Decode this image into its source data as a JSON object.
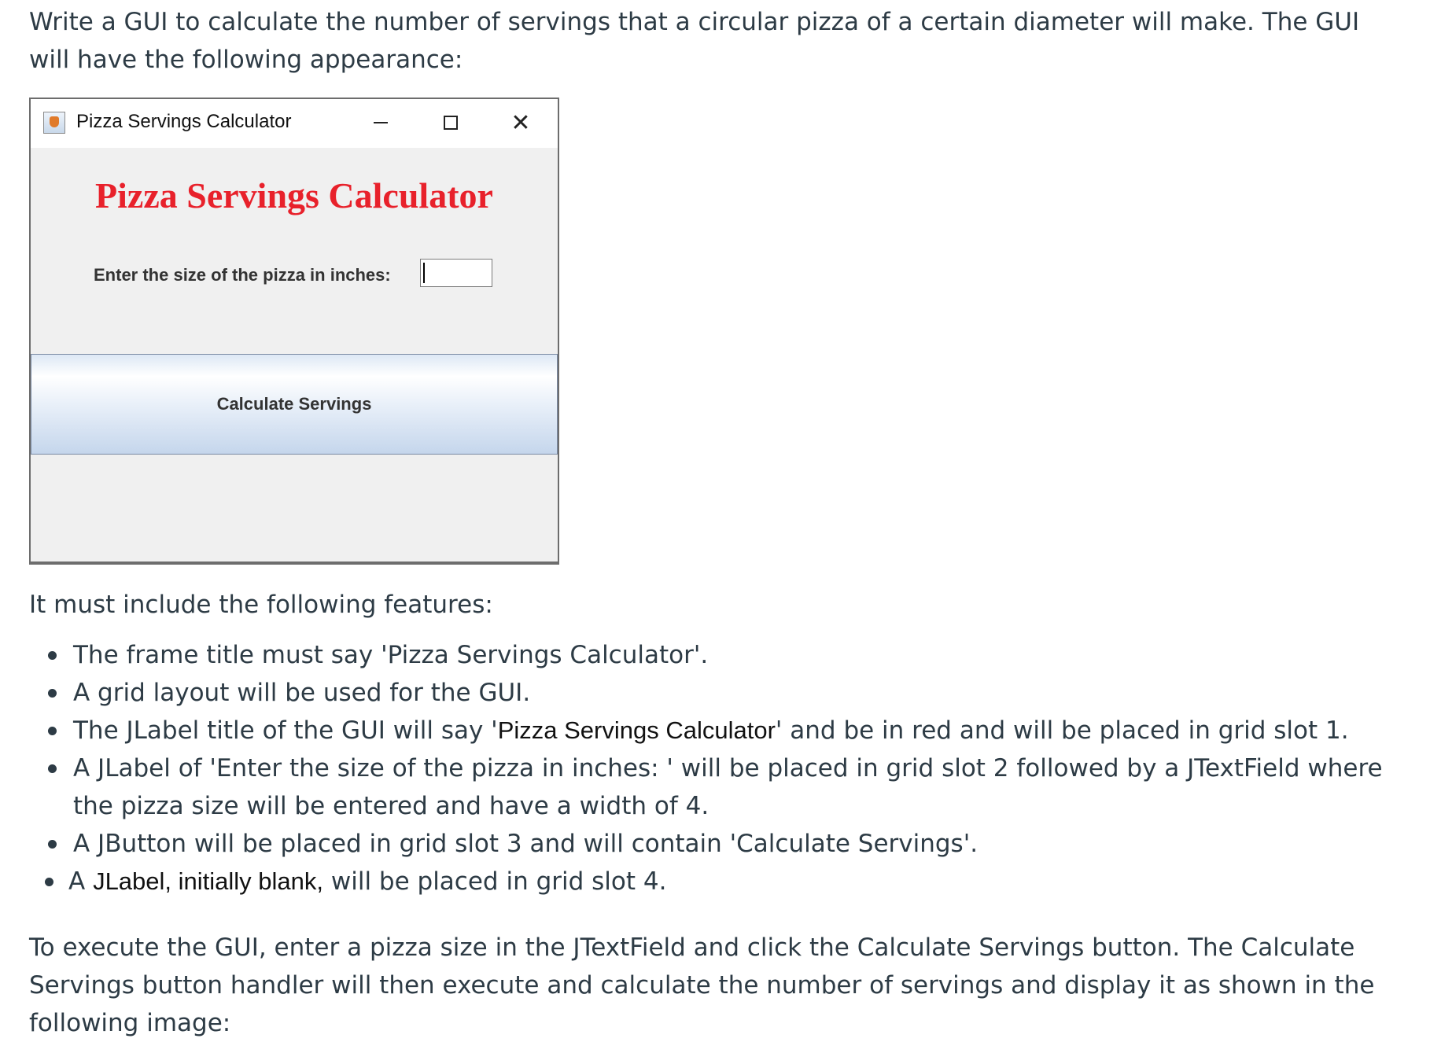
{
  "intro": "Write a GUI to calculate the number of servings that a circular pizza of a certain diameter will make. The GUI will have the following appearance:",
  "gui": {
    "window_title": "Pizza Servings Calculator",
    "heading": "Pizza Servings Calculator",
    "heading_color": "#e8212b",
    "size_label": "Enter the size of the pizza in inches:",
    "size_input_value": "",
    "button_label": "Calculate Servings",
    "icons": {
      "app": "java-cup-icon",
      "minimize": "minimize-icon",
      "maximize": "maximize-icon",
      "close": "close-icon"
    },
    "close_glyph": "✕"
  },
  "features_intro": "It must include the following features:",
  "features": [
    {
      "text": "The frame title must say 'Pizza Servings Calculator'."
    },
    {
      "text": "A grid layout will be used for the GUI."
    },
    {
      "pre": "The JLabel title of the GUI will say '",
      "em": "Pizza Servings Calculator",
      "post": "' and be in red and will be placed in  grid slot 1."
    },
    {
      "text": "A JLabel of 'Enter the size of the pizza in inches: ' will be placed in grid slot 2 followed by a JTextField where the pizza size will be entered and have a width of 4."
    },
    {
      "text": "A JButton will be placed in grid slot 3 and will contain 'Calculate Servings'."
    },
    {
      "pre": "A ",
      "em": "JLabel, initially blank,",
      "post": " will be placed in grid slot 4."
    }
  ],
  "outro": "To execute the GUI, enter a pizza size in the JTextField and click the Calculate Servings button. The Calculate Servings button handler will then execute and calculate the number of servings and display it as shown in the following image:"
}
